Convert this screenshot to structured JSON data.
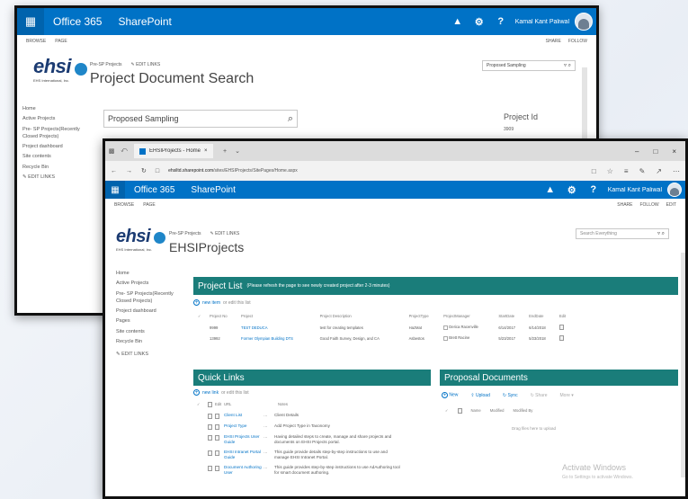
{
  "common": {
    "suite_app": "Office 365",
    "suite_site": "SharePoint",
    "user_name_back": "Kamal Kant Paliwal",
    "user_name_front": "Kamal Kant Paliwal",
    "ribbon_browse": "BROWSE",
    "ribbon_page": "PAGE",
    "ribbon_share": "SHARE",
    "ribbon_follow": "FOLLOW",
    "ribbon_edit": "EDIT",
    "logo_text": "ehsi",
    "logo_sub": "EHS International, Inc.",
    "topnav_pre_sp": "Pre-SP Projects",
    "edit_links": "EDIT LINKS",
    "left_nav": [
      "Home",
      "Active Projects",
      "Pre- SP Projects(Recently Closed Projects)",
      "Project dashboard",
      "Pages",
      "Site contents",
      "Recycle Bin"
    ],
    "back_left_nav": [
      "Home",
      "Active Projects",
      "Pre- SP Projects(Recently Closed Projects)",
      "Project dashboard",
      "Site contents",
      "Recycle Bin"
    ]
  },
  "back": {
    "page_title": "Project Document Search",
    "search_value": "Proposed Sampling",
    "site_search_value": "Proposed Sampling",
    "project_id_label": "Project Id",
    "project_id_value": "3909"
  },
  "front": {
    "tab_title": "EHSIProjects - Home",
    "new_tab": "+",
    "url_host": "ehsiltd.sharepoint.com",
    "url_path": "/sites/EHSIProjects/SitePages/Home.aspx",
    "page_title": "EHSIProjects",
    "site_search_placeholder": "Search Everything",
    "project_list": {
      "title": "Project List",
      "note": "(Please refresh the page to see newly created project after 2-3 minutes)",
      "new_item": "new item",
      "or_edit": "or edit this list",
      "columns": [
        "Project No",
        "Project",
        "Project Description",
        "ProjectType",
        "ProjectManager",
        "StartDate",
        "EndDate",
        "Edit"
      ],
      "rows": [
        [
          "9999",
          "TEST DEDUCA",
          "test for creating templates",
          "HazMat",
          "Derica Racenville",
          "6/14/2017",
          "6/14/2018"
        ],
        [
          "13992",
          "Former Olympian Building DTS",
          "Good Faith Survey, Design, and CA",
          "Asbestos",
          "Brett Racine",
          "5/23/2017",
          "5/23/2018"
        ]
      ]
    },
    "quick_links": {
      "title": "Quick Links",
      "new_link": "new link",
      "or_edit": "or edit this list",
      "col_edit": "Edit",
      "col_url": "URL",
      "col_notes": "Notes",
      "rows": [
        {
          "name": "Client List",
          "notes": "Client Details"
        },
        {
          "name": "Project Type",
          "notes": "Add Project Type in Taxonomy"
        },
        {
          "name": "EHSI Projects User Guide",
          "notes": "Having detailed steps to create, manage and share projects and documents on EHSI Projects portal."
        },
        {
          "name": "EHSI Intranet Portal Guide",
          "notes": "This guide provide details step-by-step instructions to use and manage EHSI Intranet Portal."
        },
        {
          "name": "Document Authoring User",
          "notes": "This guide provides step-by-step instructions to use AdAuthoring tool for smart document authoring."
        }
      ]
    },
    "proposal_docs": {
      "title": "Proposal Documents",
      "new": "New",
      "upload": "Upload",
      "sync": "Sync",
      "share": "Share",
      "more": "More",
      "col_name": "Name",
      "col_modified": "Modified",
      "col_modified_by": "Modified By",
      "drag_hint": "Drag files here to upload"
    },
    "watermark_title": "Activate Windows",
    "watermark_sub": "Go to Settings to activate Windows."
  },
  "colors": {
    "suite_blue": "#0072c6",
    "webpart_teal": "#1a7d7a",
    "link_blue": "#0072c6"
  }
}
